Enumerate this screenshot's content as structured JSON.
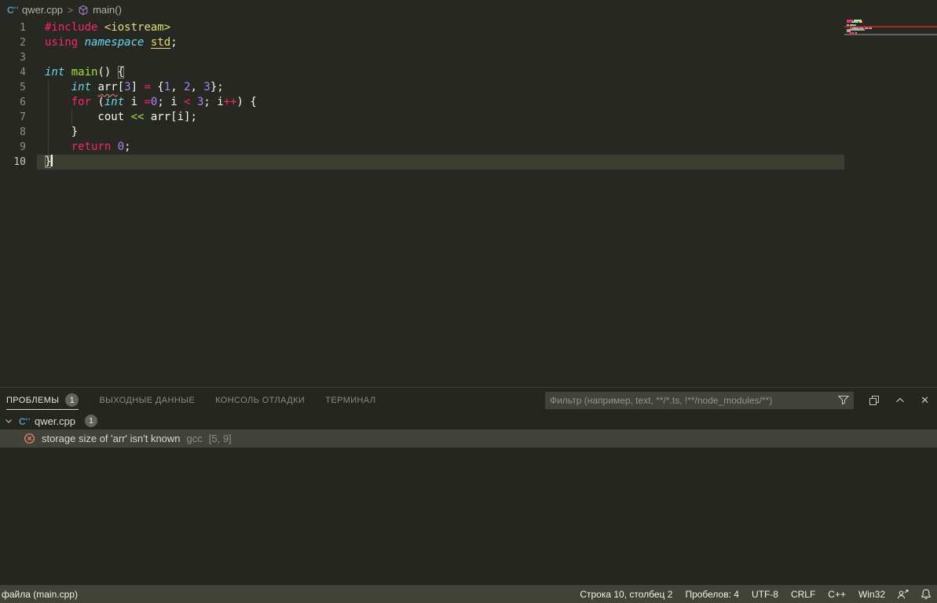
{
  "breadcrumb": {
    "file": "qwer.cpp",
    "symbol": "main()"
  },
  "icons": {
    "breadcrumb_separator": ">",
    "close_panel": "✕"
  },
  "colors": {
    "editor_bg": "#272822",
    "statusbar_bg": "#414339",
    "line_highlight": "#3e3d32",
    "keyword_pink": "#f92672",
    "type_cyan": "#66d9ef",
    "function_green": "#a6e22e",
    "string_yellow": "#e6db74",
    "number_purple": "#ae81ff",
    "error_red": "#f48771",
    "cpp_icon_blue": "#519aba",
    "symbol_purple": "#b180d7"
  },
  "editor": {
    "lines": [
      {
        "num": "1",
        "tokens": [
          {
            "t": "#include",
            "s": "k"
          },
          {
            "t": " "
          },
          {
            "t": "<iostream>",
            "s": "s"
          }
        ]
      },
      {
        "num": "2",
        "tokens": [
          {
            "t": "using",
            "s": "k"
          },
          {
            "t": " "
          },
          {
            "t": "namespace",
            "s": "t"
          },
          {
            "t": " "
          },
          {
            "t": "std",
            "s": "s u"
          },
          {
            "t": ";"
          }
        ]
      },
      {
        "num": "3",
        "tokens": []
      },
      {
        "num": "4",
        "tokens": [
          {
            "t": "int",
            "s": "t"
          },
          {
            "t": " "
          },
          {
            "t": "main",
            "s": "f"
          },
          {
            "t": "() "
          },
          {
            "t": "{",
            "s": "w br"
          }
        ]
      },
      {
        "num": "5",
        "tokens": [
          {
            "t": "    "
          },
          {
            "t": "int",
            "s": "t"
          },
          {
            "t": " "
          },
          {
            "t": "arr",
            "s": "w sq"
          },
          {
            "t": "["
          },
          {
            "t": "3",
            "s": "n"
          },
          {
            "t": "] "
          },
          {
            "t": "=",
            "s": "k"
          },
          {
            "t": " {"
          },
          {
            "t": "1",
            "s": "n"
          },
          {
            "t": ", "
          },
          {
            "t": "2",
            "s": "n"
          },
          {
            "t": ", "
          },
          {
            "t": "3",
            "s": "n"
          },
          {
            "t": "};"
          }
        ]
      },
      {
        "num": "6",
        "tokens": [
          {
            "t": "    "
          },
          {
            "t": "for",
            "s": "k"
          },
          {
            "t": " ("
          },
          {
            "t": "int",
            "s": "t"
          },
          {
            "t": " i "
          },
          {
            "t": "=",
            "s": "k"
          },
          {
            "t": "0",
            "s": "n"
          },
          {
            "t": "; i "
          },
          {
            "t": "<",
            "s": "k"
          },
          {
            "t": " "
          },
          {
            "t": "3",
            "s": "n"
          },
          {
            "t": "; i"
          },
          {
            "t": "++",
            "s": "k"
          },
          {
            "t": ") {"
          }
        ]
      },
      {
        "num": "7",
        "tokens": [
          {
            "t": "        cout "
          },
          {
            "t": "<<",
            "s": "f"
          },
          {
            "t": " arr[i];"
          }
        ]
      },
      {
        "num": "8",
        "tokens": [
          {
            "t": "    }"
          }
        ]
      },
      {
        "num": "9",
        "tokens": [
          {
            "t": "    "
          },
          {
            "t": "return",
            "s": "k"
          },
          {
            "t": " "
          },
          {
            "t": "0",
            "s": "n"
          },
          {
            "t": ";"
          }
        ]
      },
      {
        "num": "10",
        "tokens": [
          {
            "t": "}",
            "s": "w br"
          }
        ],
        "current": true,
        "cursor": true
      }
    ],
    "error_line": 5,
    "current_line": 10
  },
  "panel": {
    "tabs": [
      {
        "label": "ПРОБЛЕМЫ",
        "badge": "1",
        "active": true
      },
      {
        "label": "ВЫХОДНЫЕ ДАННЫЕ"
      },
      {
        "label": "КОНСОЛЬ ОТЛАДКИ"
      },
      {
        "label": "ТЕРМИНАЛ"
      }
    ],
    "filter_placeholder": "Фильтр (например, text, **/*.ts, !**/node_modules/**)",
    "problems": {
      "file": {
        "name": "qwer.cpp",
        "badge": "1"
      },
      "items": [
        {
          "message": "storage size of 'arr' isn't known",
          "source": "gcc",
          "position": "[5, 9]"
        }
      ]
    }
  },
  "statusbar": {
    "left": "файла (main.cpp)",
    "items": [
      "Строка 10, столбец 2",
      "Пробелов: 4",
      "UTF-8",
      "CRLF",
      "C++",
      "Win32"
    ]
  }
}
